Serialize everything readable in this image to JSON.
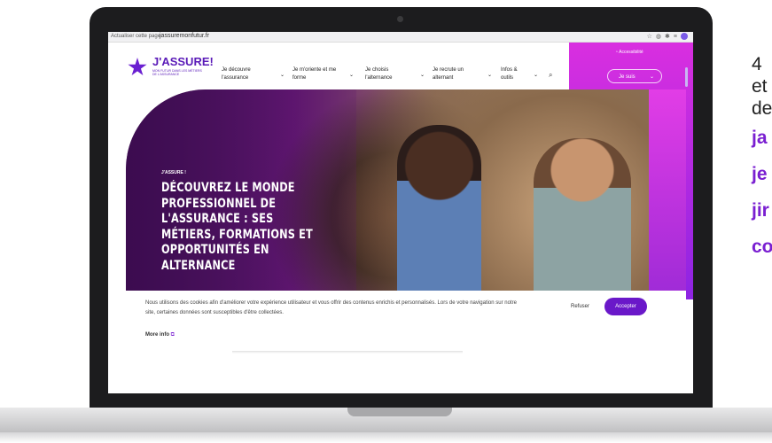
{
  "right_side": {
    "line1": "4",
    "line2": "et",
    "line3": "de",
    "links": [
      "ja",
      "je",
      "jir",
      "co"
    ]
  },
  "browser": {
    "reload_label": "Actualiser cette page",
    "url": "jassuremonfutur.fr",
    "icons": [
      "star-icon",
      "extension-icon",
      "puzzle-icon",
      "menu-icon"
    ],
    "avatar_letter": "E"
  },
  "site": {
    "logo": "J'ASSURE!",
    "logo_sub": "MON FUTUR DANS LES MÉTIERS DE L'ASSURANCE",
    "nav": [
      {
        "label": "Je découvre l'assurance"
      },
      {
        "label": "Je m'oriente et me forme"
      },
      {
        "label": "Je choisis l'alternance"
      },
      {
        "label": "Je recrute un alternant"
      },
      {
        "label": "Infos & outils"
      }
    ],
    "accessibility": "Accessibilité",
    "je_suis": "Je suis"
  },
  "hero": {
    "kicker": "J'ASSURE !",
    "title": "DÉCOUVREZ LE MONDE PROFESSIONNEL DE L'ASSURANCE : SES MÉTIERS, FORMATIONS ET OPPORTUNITÉS EN ALTERNANCE"
  },
  "cookie": {
    "text": "Nous utilisons des cookies afin d'améliorer votre expérience utilisateur et vous offrir des contenus enrichis et personnalisés. Lors de votre navigation sur notre site, certaines données sont susceptibles d'être collectées.",
    "more_info": "More info",
    "refuse": "Refuser",
    "accept": "Accepter"
  },
  "colors": {
    "brand": "#6a18c9",
    "accent": "#d92fe0"
  }
}
